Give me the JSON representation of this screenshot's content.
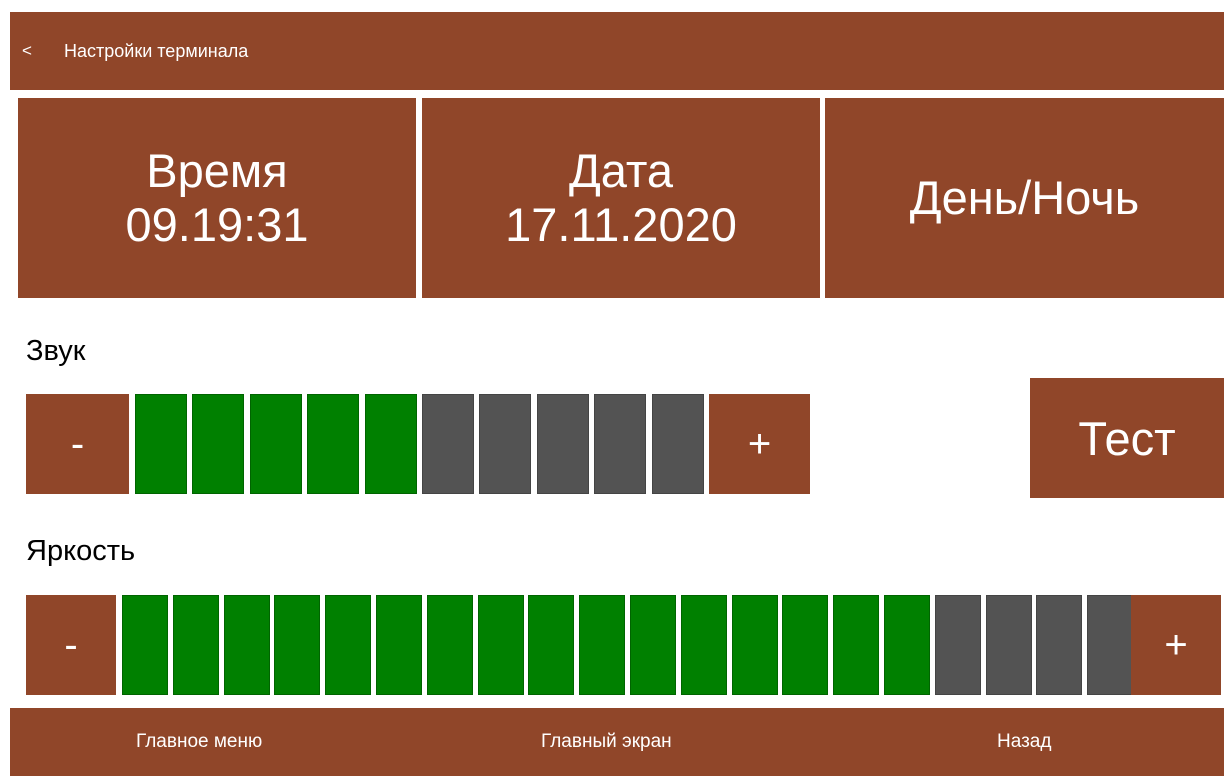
{
  "header": {
    "back_label": "<",
    "title": "Настройки терминала"
  },
  "tiles": {
    "time_label": "Время",
    "time_value": "09.19:31",
    "date_label": "Дата",
    "date_value": "17.11.2020",
    "daynight_label": "День/Ночь"
  },
  "sound": {
    "label": "Звук",
    "minus": "-",
    "plus": "+",
    "level": 5,
    "max": 10,
    "test_label": "Тест"
  },
  "brightness": {
    "label": "Яркость",
    "minus": "-",
    "plus": "+",
    "level": 16,
    "max": 20
  },
  "footer": {
    "main_menu": "Главное меню",
    "home_screen": "Главный экран",
    "back": "Назад"
  },
  "colors": {
    "brand": "#904629",
    "active_segment": "#008000",
    "inactive_segment": "#535353"
  }
}
